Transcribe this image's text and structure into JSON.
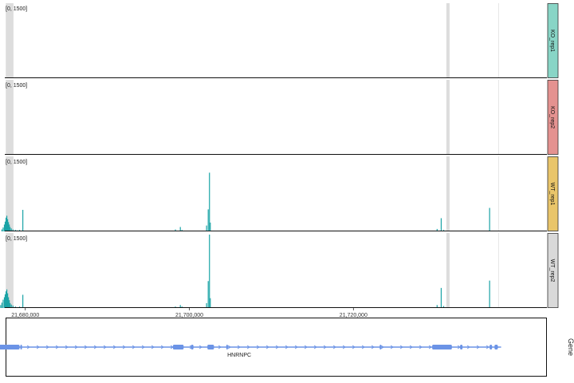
{
  "chart_data": {
    "type": "area",
    "x_range": [
      21677500,
      21743000
    ],
    "x_ticks": [
      21680000,
      21700000,
      21720000
    ],
    "x_tick_labels": [
      "21,680,000",
      "21,700,000",
      "21,720,000"
    ],
    "highlight_regions": [
      [
        21677620,
        21678560
      ],
      [
        21731330,
        21731720
      ]
    ],
    "reference_line": 21737700,
    "colors": {
      "signal": "#1aa3a6",
      "highlight": "#dddddd",
      "gene": "#6b93e6"
    },
    "tracks": [
      {
        "name": "KO_rep1",
        "range_label": "[0, 1500]",
        "ylim": [
          0,
          1500
        ],
        "strip_color": "#88d5c6",
        "peaks": []
      },
      {
        "name": "KO_rep2",
        "range_label": "[0, 1500]",
        "ylim": [
          0,
          1500
        ],
        "strip_color": "#e49290",
        "peaks": []
      },
      {
        "name": "WT_rep1",
        "range_label": "[0, 1500]",
        "ylim": [
          0,
          1500
        ],
        "strip_color": "#e9c56a",
        "peaks": [
          [
            21677150,
            40
          ],
          [
            21677300,
            80
          ],
          [
            21677450,
            140
          ],
          [
            21677550,
            200
          ],
          [
            21677650,
            280
          ],
          [
            21677750,
            320
          ],
          [
            21677850,
            250
          ],
          [
            21677950,
            190
          ],
          [
            21678050,
            140
          ],
          [
            21678150,
            90
          ],
          [
            21678300,
            60
          ],
          [
            21678500,
            40
          ],
          [
            21678800,
            30
          ],
          [
            21679000,
            20
          ],
          [
            21679300,
            30
          ],
          [
            21679700,
            440
          ],
          [
            21698300,
            40
          ],
          [
            21698900,
            90
          ],
          [
            21699100,
            30
          ],
          [
            21702100,
            120
          ],
          [
            21702300,
            450
          ],
          [
            21702450,
            1200
          ],
          [
            21702550,
            180
          ],
          [
            21730200,
            50
          ],
          [
            21730700,
            270
          ],
          [
            21731000,
            30
          ],
          [
            21736600,
            480
          ]
        ]
      },
      {
        "name": "WT_rep2",
        "range_label": "[0, 1500]",
        "ylim": [
          0,
          1500
        ],
        "strip_color": "#d9d9d9",
        "peaks": [
          [
            21676500,
            40
          ],
          [
            21676800,
            50
          ],
          [
            21677000,
            60
          ],
          [
            21677150,
            110
          ],
          [
            21677300,
            170
          ],
          [
            21677450,
            220
          ],
          [
            21677550,
            280
          ],
          [
            21677650,
            340
          ],
          [
            21677750,
            380
          ],
          [
            21677850,
            300
          ],
          [
            21677950,
            220
          ],
          [
            21678050,
            160
          ],
          [
            21678150,
            100
          ],
          [
            21678300,
            70
          ],
          [
            21678500,
            50
          ],
          [
            21678800,
            30
          ],
          [
            21679300,
            30
          ],
          [
            21679700,
            270
          ],
          [
            21698300,
            30
          ],
          [
            21698900,
            60
          ],
          [
            21699100,
            30
          ],
          [
            21702100,
            100
          ],
          [
            21702300,
            550
          ],
          [
            21702450,
            1500
          ],
          [
            21702550,
            200
          ],
          [
            21730200,
            60
          ],
          [
            21730700,
            410
          ],
          [
            21731000,
            40
          ],
          [
            21736600,
            560
          ]
        ]
      }
    ],
    "gene": {
      "name": "HNRNPC",
      "span": [
        21676100,
        21738000
      ],
      "exons": [
        [
          21676200,
          21679300
        ],
        [
          21679400,
          21679600
        ],
        [
          21698000,
          21699300
        ],
        [
          21700200,
          21700500
        ],
        [
          21702200,
          21703000
        ],
        [
          21704500,
          21704700
        ],
        [
          21723200,
          21723400
        ],
        [
          21729600,
          21732000
        ],
        [
          21733000,
          21733300
        ],
        [
          21736600,
          21736900
        ],
        [
          21737200,
          21737600
        ]
      ]
    }
  },
  "side_label": "Gene"
}
